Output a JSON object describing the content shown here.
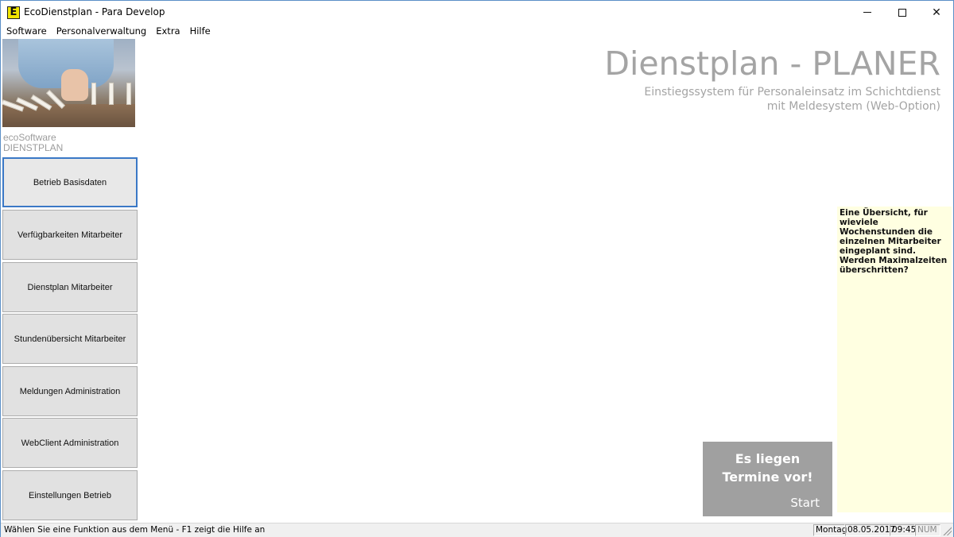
{
  "window": {
    "title": "EcoDienstplan - Para Develop",
    "app_icon_letter": "E",
    "controls": {
      "minimize_icon": "minimize-icon",
      "maximize_icon": "maximize-icon",
      "close_icon": "close-icon",
      "close_label": "✕"
    }
  },
  "menu": {
    "items": [
      "Software",
      "Personalverwaltung",
      "Extra",
      "Hilfe"
    ]
  },
  "sidebar": {
    "brand_line1": "ecoSoftware",
    "brand_line2": "DIENSTPLAN",
    "buttons": [
      "Betrieb Basisdaten",
      "Verfügbarkeiten Mitarbeiter",
      "Dienstplan Mitarbeiter",
      "Stundenübersicht Mitarbeiter",
      "Meldungen Administration",
      "WebClient Administration",
      "Einstellungen Betrieb"
    ]
  },
  "main": {
    "title": "Dienstplan - PLANER",
    "subtitle_line1": "Einstiegssystem für Personaleinsatz im Schichtdienst",
    "subtitle_line2": "mit Meldesystem (Web-Option)",
    "info_text": "Eine Übersicht, für wieviele Wochenstunden die einzelnen Mitarbeiter eingeplant sind. Werden Maximalzeiten überschritten?",
    "appointments": {
      "line1": "Es liegen",
      "line2": "Termine vor!",
      "start_label": "Start"
    }
  },
  "statusbar": {
    "message": "Wählen Sie eine Funktion aus dem Menü - F1 zeigt die Hilfe an",
    "day": "Montag",
    "date": "08.05.2017",
    "time": "09:45",
    "num": "NUM"
  },
  "colors": {
    "accent_border": "#3a78c6",
    "info_background": "#ffffe1",
    "tile_background": "#a0a0a0",
    "title_gray": "#a4a4a4"
  }
}
